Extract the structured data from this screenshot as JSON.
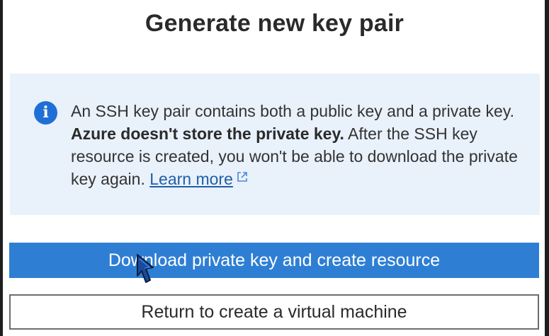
{
  "dialog": {
    "title": "Generate new key pair",
    "info": {
      "icon": "info-icon",
      "text_part1": "An SSH key pair contains both a public key and a private key. ",
      "text_bold": "Azure doesn't store the private key.",
      "text_part2": " After the SSH key resource is created, you won't be able to download the private key again. ",
      "learn_more": "Learn more",
      "link_icon": "external-link-icon"
    },
    "primary_button": "Download private key and create resource",
    "secondary_button": "Return to create a virtual machine"
  },
  "colors": {
    "primary": "#2e7fd4",
    "info_background": "#e9f1fb",
    "info_icon": "#1f6fd6",
    "link": "#1f5fa8"
  }
}
